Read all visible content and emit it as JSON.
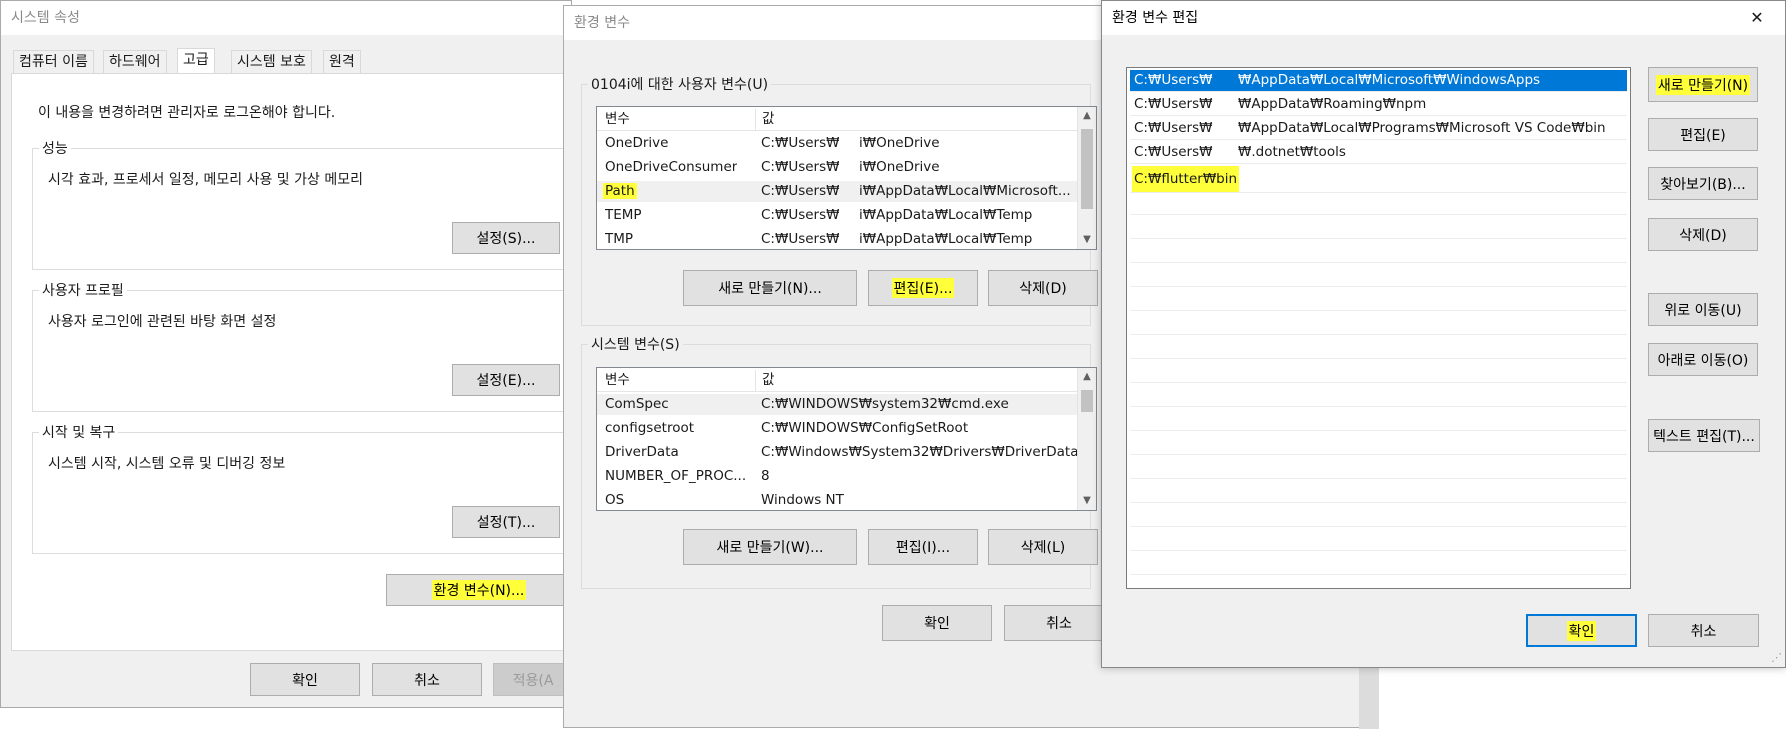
{
  "sysprops": {
    "title": "시스템 속성",
    "tabs": [
      "컴퓨터 이름",
      "하드웨어",
      "고급",
      "시스템 보호",
      "원격"
    ],
    "admin_note": "이 내용을 변경하려면 관리자로 로그온해야 합니다.",
    "performance": {
      "label": "성능",
      "desc": "시각 효과, 프로세서 일정, 메모리 사용 및 가상 메모리",
      "button": "설정(S)..."
    },
    "profile": {
      "label": "사용자 프로필",
      "desc": "사용자 로그인에 관련된 바탕 화면 설정",
      "button": "설정(E)..."
    },
    "startup": {
      "label": "시작 및 복구",
      "desc": "시스템 시작, 시스템 오류 및 디버깅 정보",
      "button": "설정(T)..."
    },
    "env_button": "환경 변수(N)...",
    "ok": "확인",
    "cancel": "취소",
    "apply": "적용(A"
  },
  "envvars": {
    "title": "환경 변수",
    "user_label": "0104i에 대한 사용자 변수(U)",
    "col_var": "변수",
    "col_value": "값",
    "user_rows": [
      {
        "name": "OneDrive",
        "val1": "C:₩Users₩",
        "val2": "i₩OneDrive"
      },
      {
        "name": "OneDriveConsumer",
        "val1": "C:₩Users₩",
        "val2": "i₩OneDrive"
      },
      {
        "name": "Path",
        "val1": "C:₩Users₩",
        "val2": "i₩AppData₩Local₩Microsoft..."
      },
      {
        "name": "TEMP",
        "val1": "C:₩Users₩",
        "val2": "i₩AppData₩Local₩Temp"
      },
      {
        "name": "TMP",
        "val1": "C:₩Users₩",
        "val2": "i₩AppData₩Local₩Temp"
      }
    ],
    "user_new": "새로 만들기(N)...",
    "user_edit": "편집(E)...",
    "user_delete": "삭제(D)",
    "system_label": "시스템 변수(S)",
    "system_rows": [
      {
        "name": "ComSpec",
        "value": "C:₩WINDOWS₩system32₩cmd.exe"
      },
      {
        "name": "configsetroot",
        "value": "C:₩WINDOWS₩ConfigSetRoot"
      },
      {
        "name": "DriverData",
        "value": "C:₩Windows₩System32₩Drivers₩DriverData"
      },
      {
        "name": "NUMBER_OF_PROC...",
        "value": "8"
      },
      {
        "name": "OS",
        "value": "Windows NT"
      }
    ],
    "sys_new": "새로 만들기(W)...",
    "sys_edit": "편집(I)...",
    "sys_delete": "삭제(L)",
    "ok": "확인",
    "cancel": "취소"
  },
  "editor": {
    "title": "환경 변수 편집",
    "close_glyph": "✕",
    "entries": [
      {
        "a": "C:₩Users₩",
        "b": "₩AppData₩Local₩Microsoft₩WindowsApps"
      },
      {
        "a": "C:₩Users₩",
        "b": "₩AppData₩Roaming₩npm"
      },
      {
        "a": "C:₩Users₩",
        "b": "₩AppData₩Local₩Programs₩Microsoft VS Code₩bin"
      },
      {
        "a": "C:₩Users₩",
        "b": "₩.dotnet₩tools"
      },
      {
        "a": "C:₩flutter₩bin",
        "b": ""
      }
    ],
    "new": "새로 만들기(N)",
    "edit": "편집(E)",
    "browse": "찾아보기(B)...",
    "delete": "삭제(D)",
    "move_up": "위로 이동(U)",
    "move_down": "아래로 이동(O)",
    "edit_text": "텍스트 편집(T)...",
    "ok": "확인",
    "cancel": "취소"
  },
  "colors": {
    "highlight": "#ffff3a",
    "selection": "#0078d7",
    "dialog_bg": "#f0f0f0"
  }
}
